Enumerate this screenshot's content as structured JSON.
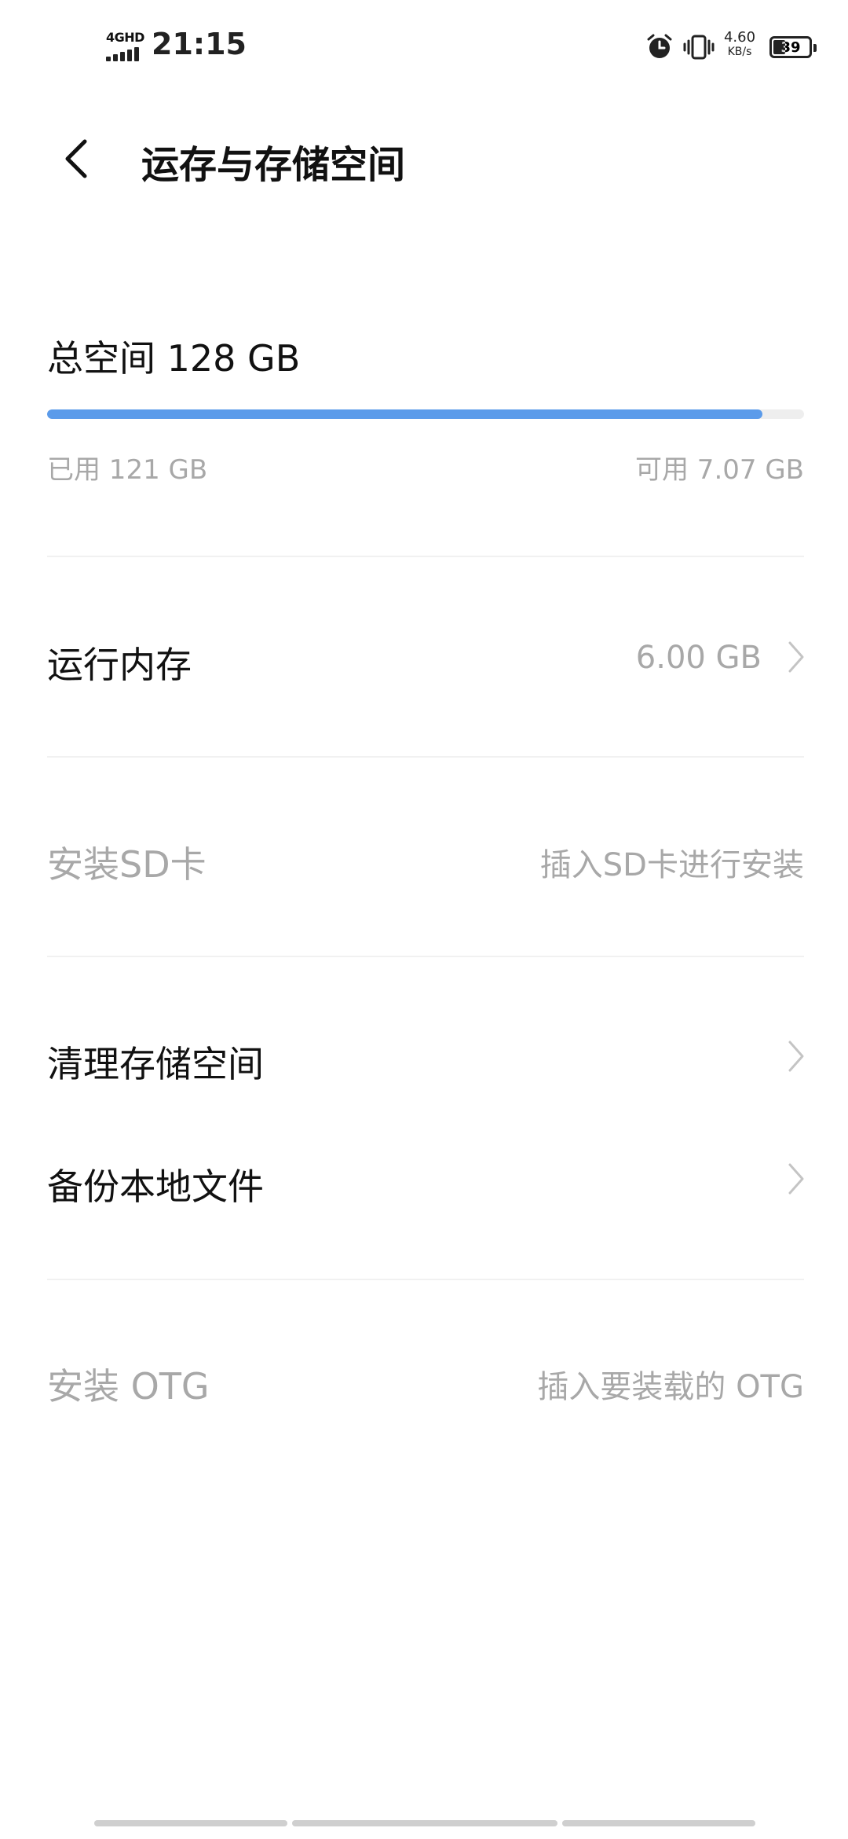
{
  "status_bar": {
    "network": "4GHD",
    "time": "21:15",
    "speed_value": "4.60",
    "speed_unit": "KB/s",
    "battery_level": "39",
    "battery_fraction": 0.39,
    "icons": [
      "signal-icon",
      "alarm-icon",
      "vibrate-icon",
      "battery-icon"
    ]
  },
  "header": {
    "back_icon": "chevron-left-icon",
    "title": "运存与存储空间"
  },
  "storage": {
    "total_label": "总空间 128 GB",
    "used_label": "已用 121 GB",
    "available_label": "可用 7.07 GB",
    "used_fraction": 0.945,
    "bar_color": "#5b9bea"
  },
  "rows": [
    {
      "label": "运行内存",
      "value": "6.00 GB",
      "chevron": true,
      "enabled": true
    },
    {
      "label": "安装SD卡",
      "value": "插入SD卡进行安装",
      "chevron": false,
      "enabled": false
    },
    {
      "label": "清理存储空间",
      "value": "",
      "chevron": true,
      "enabled": true
    },
    {
      "label": "备份本地文件",
      "value": "",
      "chevron": true,
      "enabled": true
    },
    {
      "label": "安装 OTG",
      "value": "插入要装载的 OTG",
      "chevron": false,
      "enabled": false
    }
  ],
  "colors": {
    "text_primary": "#111111",
    "text_secondary": "#a8a8a8",
    "divider": "#f1f1f1",
    "accent": "#5b9bea"
  }
}
